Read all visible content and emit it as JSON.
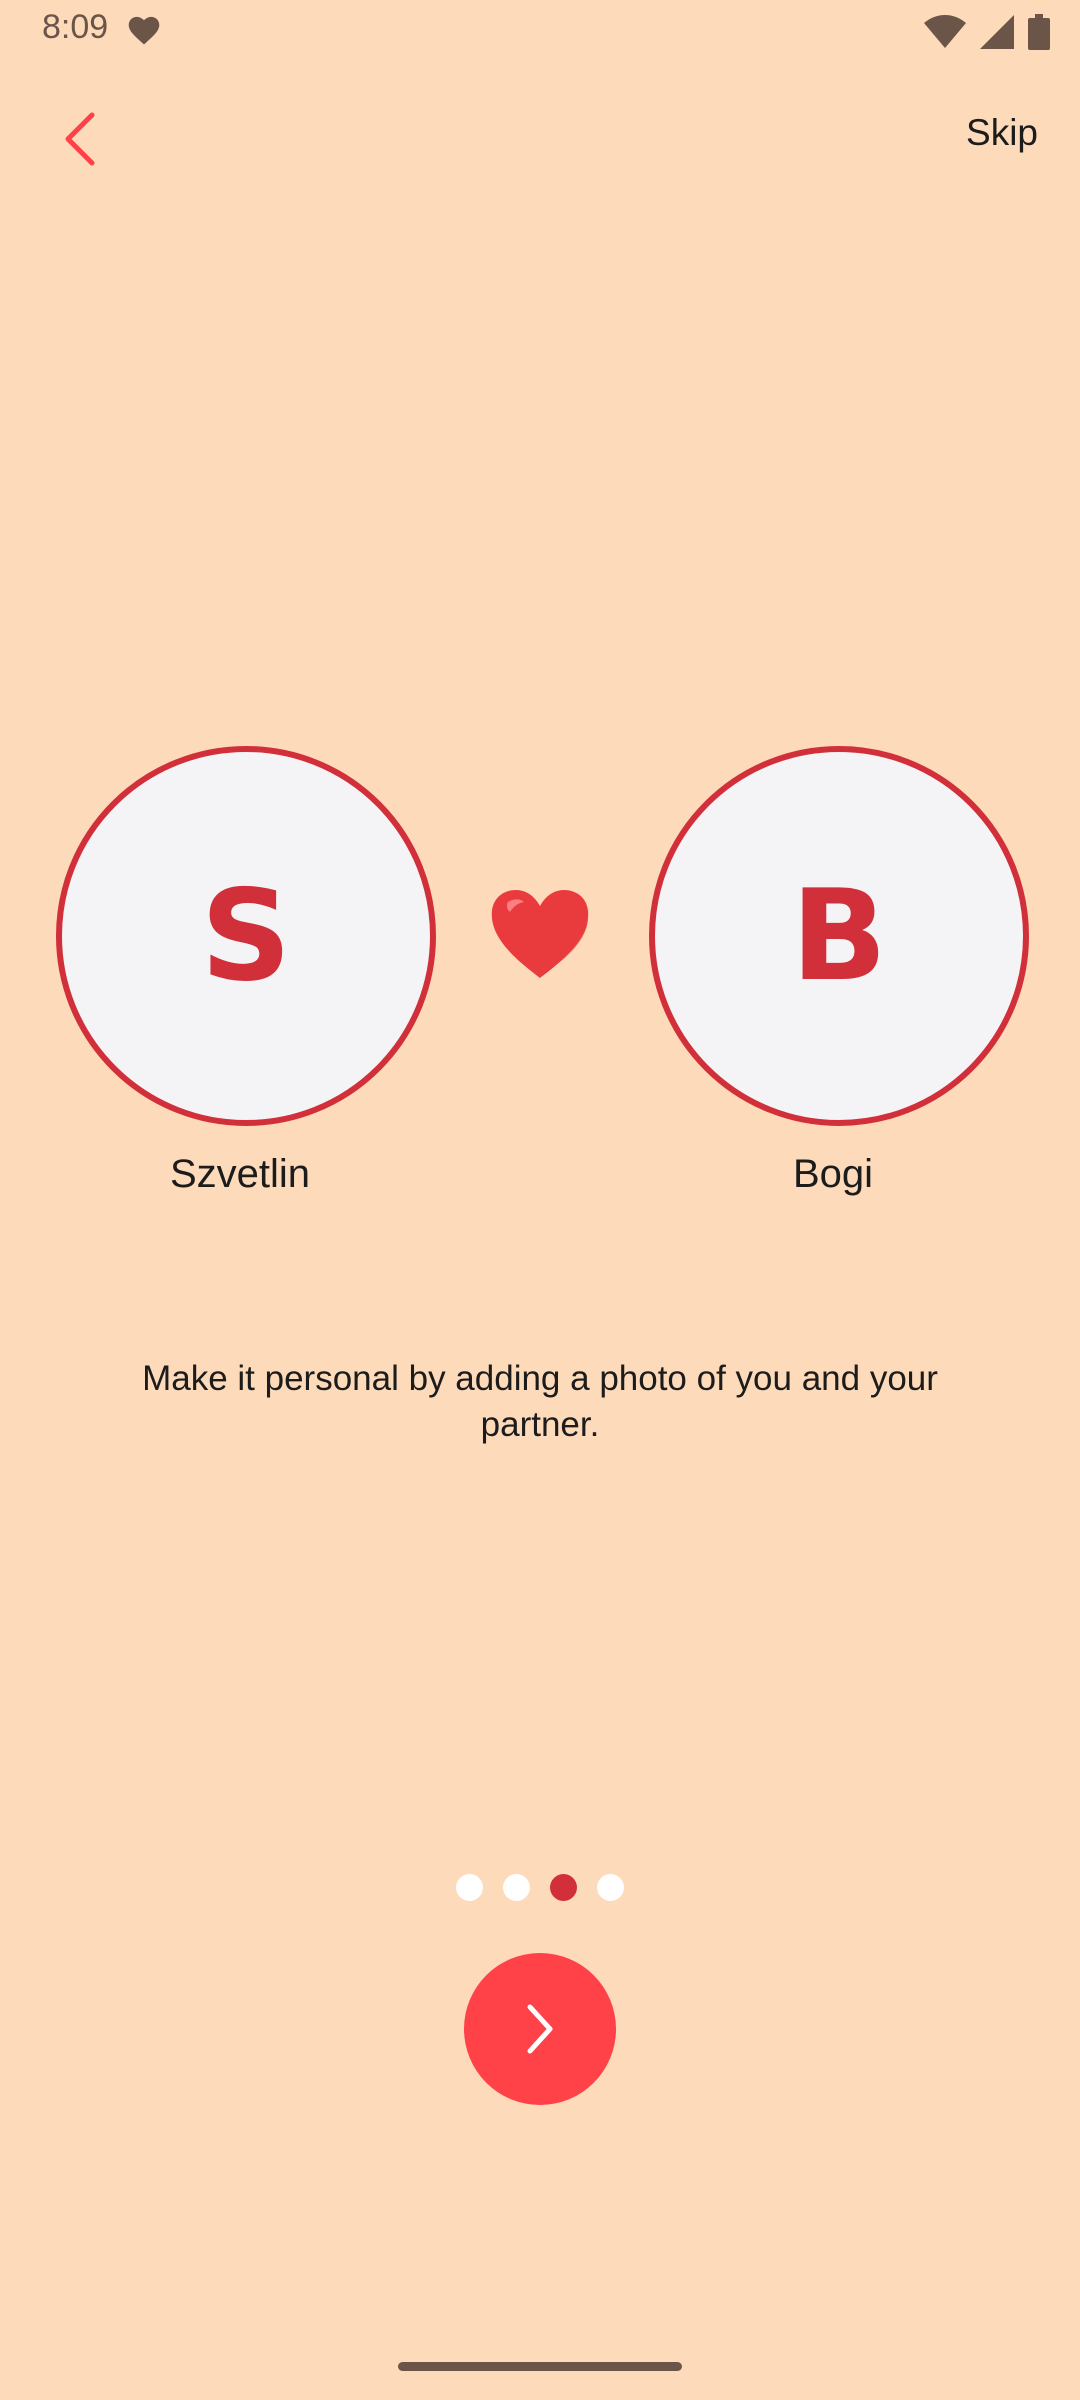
{
  "status_bar": {
    "time": "8:09",
    "icons": [
      "heart-icon",
      "wifi-icon",
      "signal-icon",
      "battery-icon"
    ]
  },
  "top_bar": {
    "back_icon": "chevron-left-icon",
    "skip_label": "Skip"
  },
  "couple": {
    "partner_one": {
      "initial": "S",
      "name": "Szvetlin"
    },
    "separator_icon": "red-heart-emoji",
    "partner_two": {
      "initial": "B",
      "name": "Bogi"
    }
  },
  "description": "Make it personal by adding a photo of you and your partner.",
  "pager": {
    "total_pages": 4,
    "current_page": 3
  },
  "next_button": {
    "icon": "chevron-right-icon"
  },
  "colors": {
    "background": "#FDDABA",
    "accent": "#D1303A",
    "button": "#FF4148",
    "avatar_fill": "#F4F3F5",
    "status_icons": "#6B5548"
  }
}
